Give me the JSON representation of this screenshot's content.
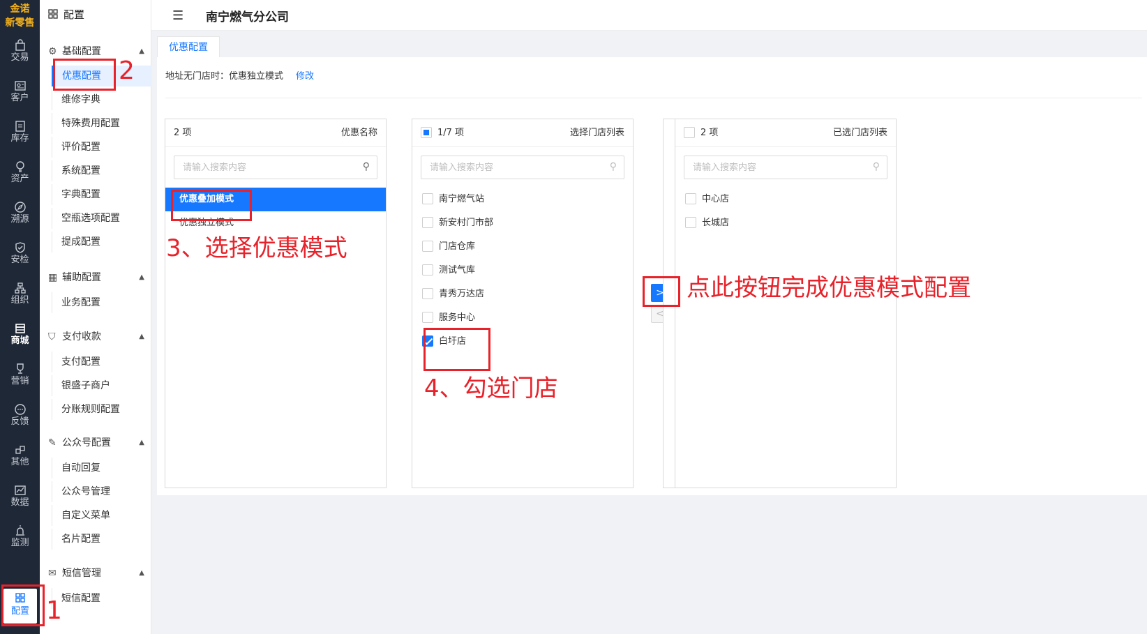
{
  "logo": {
    "line1": "金诺",
    "line2": "新零售"
  },
  "rail": [
    {
      "label": "交易",
      "icon": "bag-icon"
    },
    {
      "label": "客户",
      "icon": "id-card-icon"
    },
    {
      "label": "库存",
      "icon": "list-icon"
    },
    {
      "label": "资产",
      "icon": "bulb-icon"
    },
    {
      "label": "溯源",
      "icon": "compass-icon"
    },
    {
      "label": "安检",
      "icon": "shield-check-icon"
    },
    {
      "label": "组织",
      "icon": "org-icon"
    },
    {
      "label": "商城",
      "icon": "store-icon"
    },
    {
      "label": "营销",
      "icon": "trophy-icon"
    },
    {
      "label": "反馈",
      "icon": "chat-icon"
    },
    {
      "label": "其他",
      "icon": "blocks-icon"
    },
    {
      "label": "数据",
      "icon": "chart-icon"
    },
    {
      "label": "监测",
      "icon": "alarm-icon"
    },
    {
      "label": "配置",
      "icon": "grid-icon"
    }
  ],
  "sidebar": {
    "title": "配置",
    "groups": [
      {
        "label": "基础配置",
        "items": [
          "优惠配置",
          "维修字典",
          "特殊费用配置",
          "评价配置",
          "系统配置",
          "字典配置",
          "空瓶选项配置",
          "提成配置"
        ]
      },
      {
        "label": "辅助配置",
        "items": [
          "业务配置"
        ]
      },
      {
        "label": "支付收款",
        "items": [
          "支付配置",
          "银盛子商户",
          "分账规则配置"
        ]
      },
      {
        "label": "公众号配置",
        "items": [
          "自动回复",
          "公众号管理",
          "自定义菜单",
          "名片配置"
        ]
      },
      {
        "label": "短信管理",
        "items": [
          "短信配置"
        ]
      }
    ]
  },
  "header": {
    "title": "南宁燃气分公司"
  },
  "tab": {
    "label": "优惠配置"
  },
  "address": {
    "text": "地址无门店时：优惠独立模式",
    "edit": "修改"
  },
  "panels": {
    "left": {
      "count": "2 项",
      "title": "优惠名称",
      "placeholder": "请输入搜索内容",
      "items": [
        "优惠叠加模式",
        "优惠独立模式"
      ]
    },
    "middle": {
      "count": "1/7 项",
      "title": "选择门店列表",
      "placeholder": "请输入搜索内容",
      "items": [
        "南宁燃气站",
        "新安村门市部",
        "门店仓库",
        "测试气库",
        "青秀万达店",
        "服务中心",
        "白圩店"
      ]
    },
    "right": {
      "count": "2 项",
      "title": "已选门店列表",
      "placeholder": "请输入搜索内容",
      "items": [
        "中心店",
        "长城店"
      ]
    }
  },
  "transfer": {
    "right": ">",
    "left": "<"
  },
  "annotations": {
    "n1": "1",
    "n2": "2",
    "n3": "3、选择优惠模式",
    "n4": "4、勾选门店",
    "n5": "点此按钮完成优惠模式配置"
  },
  "colors": {
    "primary": "#1677ff",
    "rail": "#1f2837",
    "annotation": "#e8222a",
    "logo": "#f6b21b"
  }
}
